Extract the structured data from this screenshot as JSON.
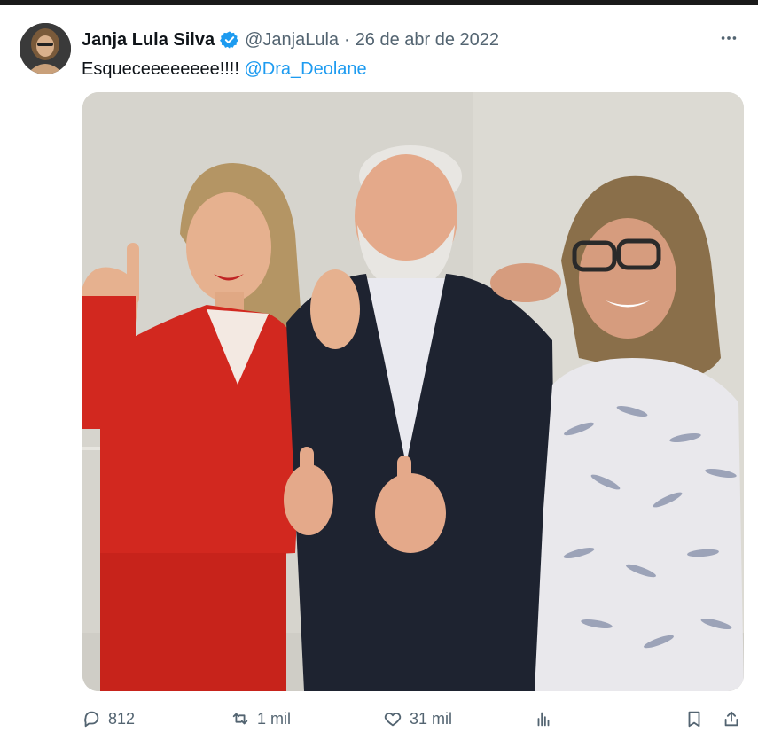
{
  "tweet": {
    "author": {
      "display_name": "Janja Lula Silva",
      "handle": "@JanjaLula",
      "verified": true
    },
    "separator": "·",
    "date": "26 de abr de 2022",
    "text_prefix": "Esqueceeeeeeee!!!!",
    "mention": "@Dra_Deolane",
    "media_icon": "photo"
  },
  "actions": {
    "replies": "812",
    "retweets": "1 mil",
    "likes": "31 mil"
  },
  "colors": {
    "link": "#1d9bf0",
    "secondary_text": "#536471",
    "verified_badge": "#1d9bf0"
  },
  "icons": [
    "more-icon",
    "verified-badge-icon",
    "reply-icon",
    "retweet-icon",
    "like-icon",
    "analytics-icon",
    "bookmark-icon",
    "share-icon"
  ]
}
